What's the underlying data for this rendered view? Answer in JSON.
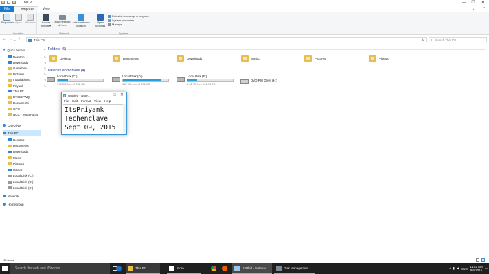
{
  "window": {
    "title": "This PC",
    "controls": {
      "minimize": "—",
      "maximize": "☐",
      "close": "✕"
    }
  },
  "ribbon": {
    "tabs": [
      "File",
      "Computer",
      "View"
    ],
    "active_tab": "Computer",
    "groups": [
      {
        "name": "Location",
        "buttons": [
          "Properties",
          "Open",
          "Rename"
        ]
      },
      {
        "name": "Network",
        "buttons": [
          "Access media ▾",
          "Map network drive ▾",
          "Add a network location"
        ]
      },
      {
        "name": "System",
        "buttons": [
          "Open Settings"
        ],
        "small": [
          "Uninstall or change a program",
          "System properties",
          "Manage"
        ]
      }
    ]
  },
  "address": {
    "back": "←",
    "forward": "→",
    "up": "↑",
    "path": "This PC",
    "search_placeholder": "Search This PC",
    "refresh": "↻"
  },
  "nav": {
    "quick_access": "Quick access",
    "quick_items": [
      "Desktop",
      "Downloads",
      "GameDev",
      "Pictures",
      "Installations",
      "Priyank",
      "This PC",
      "B7K68FWQ",
      "Documents",
      "GPU",
      "NCC - Yoga Fotos"
    ],
    "pinned_count": 6,
    "onedrive": "OneDrive",
    "this_pc": "This PC",
    "pc_items": [
      "Desktop",
      "Documents",
      "Downloads",
      "Music",
      "Pictures",
      "Videos",
      "Local Disk (C:)",
      "Local Disk (D:)",
      "Local Disk (E:)"
    ],
    "network": "Network",
    "homegroup": "Homegroup"
  },
  "content": {
    "folders_header": "Folders (6)",
    "folders": [
      "Desktop",
      "Documents",
      "Downloads",
      "Music",
      "Pictures",
      "Videos"
    ],
    "drives_header": "Devices and drives (4)",
    "drives": [
      {
        "name": "Local Disk (C:)",
        "free": "179 GB free of 232 GB",
        "used_fraction": 0.23
      },
      {
        "name": "Local Disk (D:)",
        "free": "152 GB free of 931 GB",
        "used_fraction": 0.84
      },
      {
        "name": "Local Disk (E:)",
        "free": "1.42 TB free of 1.79 TB",
        "used_fraction": 0.21
      }
    ],
    "dvd": "DVD RW Drive (H:)"
  },
  "notepad": {
    "title": "Untitled - Note...",
    "menu": [
      "File",
      "Edit",
      "Format",
      "View",
      "Help"
    ],
    "text": "ItsPriyank\nTechenclave\nSept 09, 2015"
  },
  "statusbar": {
    "items": "10 items"
  },
  "taskbar": {
    "search_placeholder": "Search the web and Windows",
    "apps": [
      "This PC",
      "Store",
      "Untitled - Notepad",
      "Disk Management"
    ],
    "tray_lang": "ENG",
    "time": "11:52 AM",
    "date": "9/9/2015"
  },
  "colors": {
    "accent": "#1979ca",
    "drive_bar": "#26a0da",
    "folder": "#e8bd4d",
    "taskbar": "#1f1f1f"
  }
}
